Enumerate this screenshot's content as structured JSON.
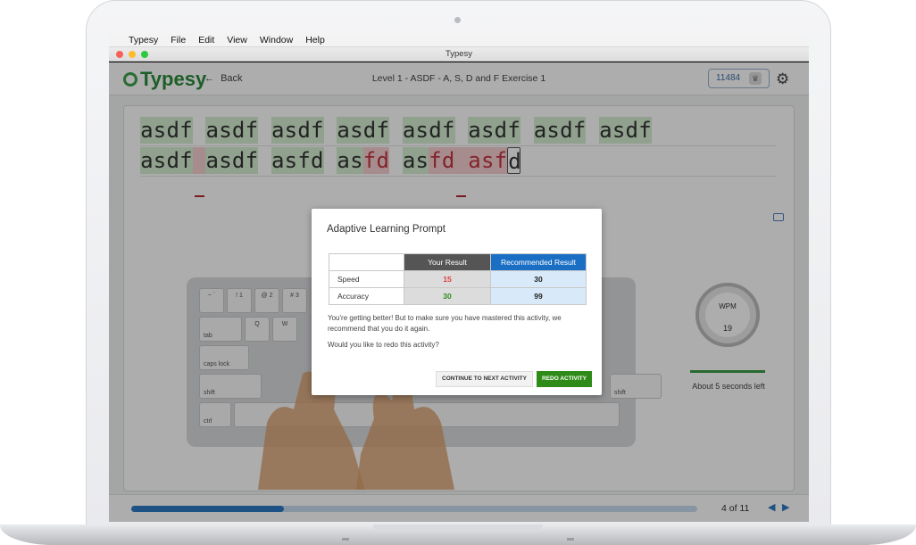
{
  "menubar": {
    "app": "Typesy",
    "items": [
      "File",
      "Edit",
      "Window",
      "Help"
    ]
  },
  "menubar_view": "View",
  "window_title": "Typesy",
  "header": {
    "logo": "Typesy",
    "back_label": "Back",
    "level_title": "Level 1 - ASDF - A, S, D and F Exercise 1",
    "score": "11484"
  },
  "typing": {
    "line1": "asdf asdf asdf asdf asdf asdf asdf asdf",
    "line2": "asdf asdf asfd asfd asfd asfd"
  },
  "keyboard": {
    "row1": [
      "~ `",
      "! 1",
      "@ 2",
      "# 3"
    ],
    "row2": [
      "tab",
      "Q",
      "W"
    ],
    "row3": [
      "caps lock"
    ],
    "row4": [
      "shift"
    ],
    "row5": [
      "ctrl"
    ]
  },
  "gauge": {
    "label": "WPM",
    "value": "19"
  },
  "time_left": "About 5 seconds left",
  "footer": {
    "progress": 0.27,
    "page": "4 of 11"
  },
  "modal": {
    "title": "Adaptive Learning Prompt",
    "col_your": "Your Result",
    "col_recommended": "Recommended Result",
    "rows": [
      {
        "label": "Speed",
        "yours": "15",
        "recommended": "30"
      },
      {
        "label": "Accuracy",
        "yours": "30",
        "recommended": "99"
      }
    ],
    "message": "You're getting better! But to make sure you have mastered this activity, we recommend that you do it again.",
    "question": "Would you like to redo this activity?",
    "continue_label": "CONTINUE TO NEXT ACTIVITY",
    "redo_label": "REDO ACTIVITY"
  },
  "colors": {
    "brand_green": "#2a8b3c",
    "accent_blue": "#2f79c3",
    "error_red": "#e03a3a",
    "success_green": "#2e8b17"
  }
}
